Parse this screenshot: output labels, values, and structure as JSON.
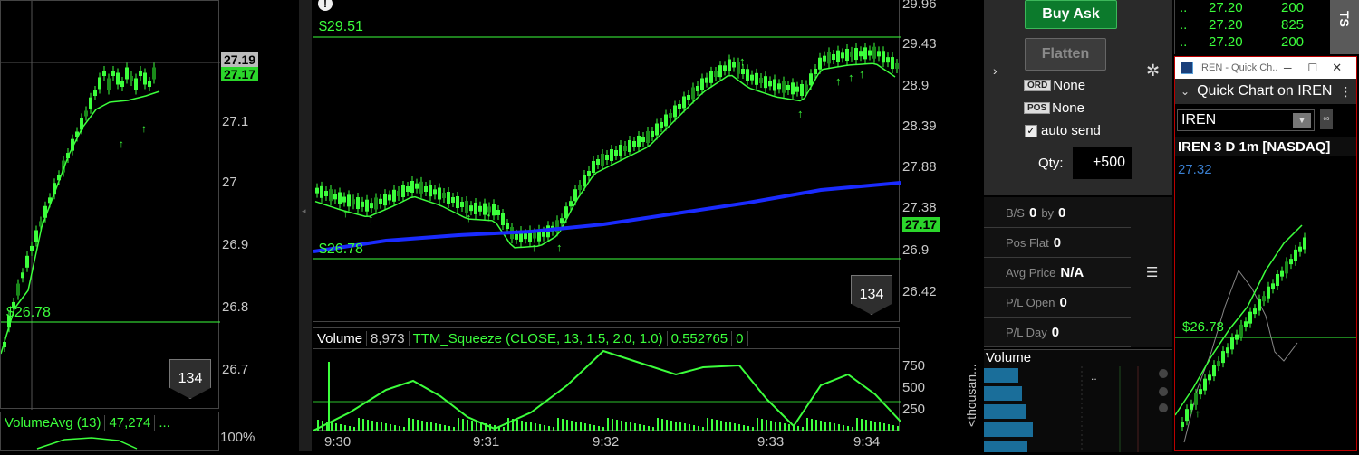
{
  "left_chart": {
    "axis_labels": [
      "27.19",
      "27.17",
      "27.1",
      "27",
      "26.9",
      "26.8",
      "26.7",
      "100%"
    ],
    "low_label": "$26.78",
    "bar_count_badge": "134",
    "volume_avg_label": "VolumeAvg (13)",
    "volume_avg_value": "47,274",
    "more": "..."
  },
  "main_chart": {
    "high_label": "$29.51",
    "low_label": "$26.78",
    "alert_icon": "exclamation-icon",
    "price_axis": [
      "29.96",
      "29.43",
      "28.9",
      "28.39",
      "27.88",
      "27.38",
      "26.9",
      "26.42"
    ],
    "current_price": "27.17",
    "bar_count_badge": "134",
    "study_bar": {
      "volume_label": "Volume",
      "volume_value": "8,973",
      "squeeze_label": "TTM_Squeeze (CLOSE, 13, 1.5, 2.0, 1.0)",
      "squeeze_value": "0.552765",
      "squeeze_zero": "0"
    },
    "volume_axis": [
      "750",
      "500",
      "250"
    ],
    "time_axis": [
      "9:30",
      "9:31",
      "9:32",
      "9:33",
      "9:34"
    ],
    "volume_unit_label": "<thousan..."
  },
  "order_panel": {
    "buy_ask": "Buy Ask",
    "flatten": "Flatten",
    "ord_tag": "ORD",
    "ord_value": "None",
    "pos_tag": "POS",
    "pos_value": "None",
    "auto_send": "auto send",
    "qty_label": "Qty:",
    "qty_value": "+500",
    "stats": [
      {
        "label": "B/S",
        "value": "0",
        "mid": "by",
        "value2": "0"
      },
      {
        "label": "Pos Flat",
        "value": "0"
      },
      {
        "label": "Avg Price",
        "value": "N/A"
      },
      {
        "label": "P/L Open",
        "value": "0"
      },
      {
        "label": "P/L Day",
        "value": "0"
      }
    ],
    "volume_profile_label": "Volume",
    "profile_dots": ".."
  },
  "time_sales": {
    "tab": "TS",
    "rows": [
      {
        "mark": "..",
        "price": "27.20",
        "size": "200"
      },
      {
        "mark": "..",
        "price": "27.20",
        "size": "825"
      },
      {
        "mark": "..",
        "price": "27.20",
        "size": "200"
      }
    ]
  },
  "quick_chart": {
    "window_title": "IREN - Quick Ch...",
    "header": "Quick Chart on IREN",
    "symbol": "IREN",
    "chart_title": "IREN 3 D 1m [NASDAQ]",
    "last_price": "27.32",
    "low_label": "$26.78"
  },
  "colors": {
    "green": "#3cff3c",
    "buy_green": "#0c7a2c",
    "blue_ma": "#1a2bff",
    "panel_grey": "#2a2a2a"
  }
}
